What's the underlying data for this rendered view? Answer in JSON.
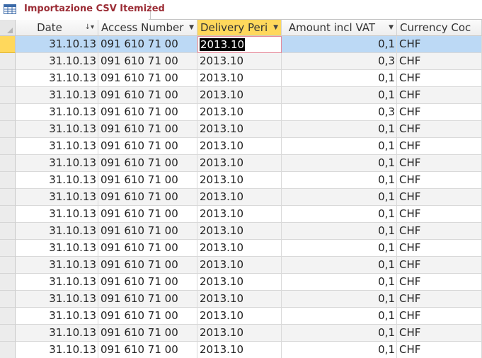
{
  "tab": {
    "title": "Importazione CSV Itemized",
    "icon": "table-icon"
  },
  "columns": [
    {
      "key": "date",
      "label": "Date",
      "indicator": "sort-descending-filter-icon"
    },
    {
      "key": "access",
      "label": "Access Number",
      "indicator": "dropdown-arrow-icon"
    },
    {
      "key": "delivery",
      "label": "Delivery Peri",
      "indicator": "dropdown-arrow-icon",
      "selected": true
    },
    {
      "key": "amount",
      "label": "Amount incl VAT",
      "indicator": "dropdown-arrow-icon"
    },
    {
      "key": "currency",
      "label": "Currency Coc",
      "indicator": ""
    }
  ],
  "rows": [
    {
      "date": "31.10.13",
      "access": "091 610 71 00",
      "delivery": "2013.10",
      "amount": "0,1",
      "currency": "CHF"
    },
    {
      "date": "31.10.13",
      "access": "091 610 71 00",
      "delivery": "2013.10",
      "amount": "0,3",
      "currency": "CHF"
    },
    {
      "date": "31.10.13",
      "access": "091 610 71 00",
      "delivery": "2013.10",
      "amount": "0,1",
      "currency": "CHF"
    },
    {
      "date": "31.10.13",
      "access": "091 610 71 00",
      "delivery": "2013.10",
      "amount": "0,1",
      "currency": "CHF"
    },
    {
      "date": "31.10.13",
      "access": "091 610 71 00",
      "delivery": "2013.10",
      "amount": "0,3",
      "currency": "CHF"
    },
    {
      "date": "31.10.13",
      "access": "091 610 71 00",
      "delivery": "2013.10",
      "amount": "0,1",
      "currency": "CHF"
    },
    {
      "date": "31.10.13",
      "access": "091 610 71 00",
      "delivery": "2013.10",
      "amount": "0,1",
      "currency": "CHF"
    },
    {
      "date": "31.10.13",
      "access": "091 610 71 00",
      "delivery": "2013.10",
      "amount": "0,1",
      "currency": "CHF"
    },
    {
      "date": "31.10.13",
      "access": "091 610 71 00",
      "delivery": "2013.10",
      "amount": "0,1",
      "currency": "CHF"
    },
    {
      "date": "31.10.13",
      "access": "091 610 71 00",
      "delivery": "2013.10",
      "amount": "0,1",
      "currency": "CHF"
    },
    {
      "date": "31.10.13",
      "access": "091 610 71 00",
      "delivery": "2013.10",
      "amount": "0,1",
      "currency": "CHF"
    },
    {
      "date": "31.10.13",
      "access": "091 610 71 00",
      "delivery": "2013.10",
      "amount": "0,1",
      "currency": "CHF"
    },
    {
      "date": "31.10.13",
      "access": "091 610 71 00",
      "delivery": "2013.10",
      "amount": "0,1",
      "currency": "CHF"
    },
    {
      "date": "31.10.13",
      "access": "091 610 71 00",
      "delivery": "2013.10",
      "amount": "0,1",
      "currency": "CHF"
    },
    {
      "date": "31.10.13",
      "access": "091 610 71 00",
      "delivery": "2013.10",
      "amount": "0,1",
      "currency": "CHF"
    },
    {
      "date": "31.10.13",
      "access": "091 610 71 00",
      "delivery": "2013.10",
      "amount": "0,1",
      "currency": "CHF"
    },
    {
      "date": "31.10.13",
      "access": "091 610 71 00",
      "delivery": "2013.10",
      "amount": "0,1",
      "currency": "CHF"
    },
    {
      "date": "31.10.13",
      "access": "091 610 71 00",
      "delivery": "2013.10",
      "amount": "0,1",
      "currency": "CHF"
    },
    {
      "date": "31.10.13",
      "access": "091 610 71 00",
      "delivery": "2013.10",
      "amount": "0,1",
      "currency": "CHF"
    }
  ],
  "colors": {
    "tab_title": "#9b2c35",
    "current_row": "#bcd9f5",
    "selected_header": "#ffd85c",
    "edit_border": "#e58a9a"
  }
}
